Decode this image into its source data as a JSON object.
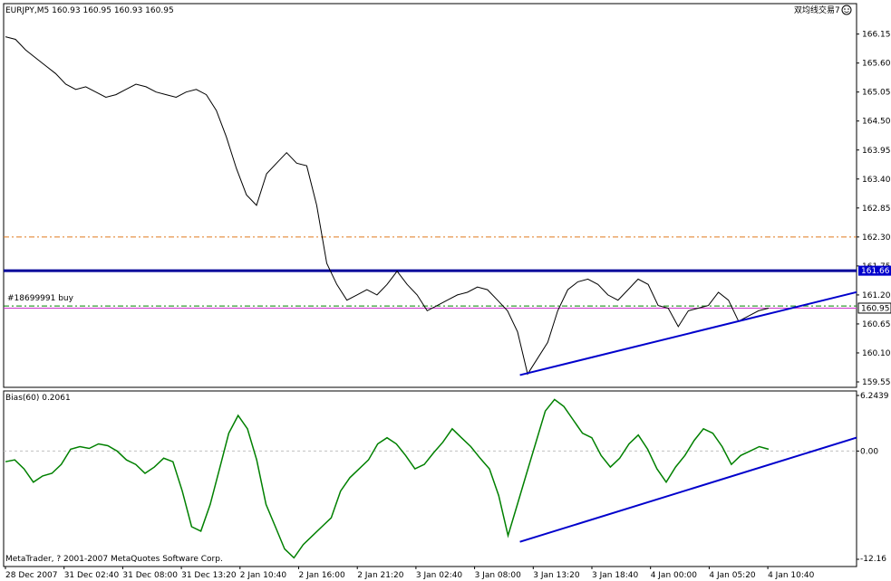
{
  "window": {
    "symbol_label": "EURJPY,M5  160.93 160.95 160.93 160.95",
    "ea_label": "双均线交易7",
    "copyright": "MetaTrader, ? 2001-2007 MetaQuotes Software Corp.",
    "indicator_label": "Bias(60) 0.2061",
    "order_label": "#18699991 buy"
  },
  "colors": {
    "price": "#000000",
    "bias": "#008000",
    "trendline": "#0000cc",
    "resistance": "#000099",
    "order_line": "#008000",
    "bid_line": "#cc33cc",
    "orange_level": "#e07a1f",
    "price_tag_bg": "#0000cc"
  },
  "chart_data": [
    {
      "type": "line",
      "title": "EURJPY,M5",
      "y_ticks": [
        "166.15",
        "165.60",
        "165.05",
        "164.50",
        "163.95",
        "163.40",
        "162.85",
        "162.30",
        "161.75",
        "161.20",
        "160.65",
        "160.10",
        "159.55"
      ],
      "ylim": [
        159.55,
        166.35
      ],
      "x_ticks": [
        "28 Dec 2007",
        "31 Dec 02:40",
        "31 Dec 08:00",
        "31 Dec 13:20",
        "2 Jan 10:40",
        "2 Jan 16:00",
        "2 Jan 21:20",
        "3 Jan 02:40",
        "3 Jan 08:00",
        "3 Jan 13:20",
        "3 Jan 18:40",
        "4 Jan 00:00",
        "4 Jan 05:20",
        "4 Jan 10:40"
      ],
      "price_tags": [
        "161.66",
        "160.95"
      ],
      "levels": {
        "orange": 162.3,
        "resistance": 161.66,
        "order": 160.99,
        "bid": 160.95
      },
      "trendline": {
        "from": [
          "3 Jan 08:00",
          159.68
        ],
        "to": [
          "4 Jan 10:40",
          161.05
        ]
      },
      "series": [
        {
          "values": [
            166.1,
            166.05,
            165.85,
            165.7,
            165.55,
            165.4,
            165.2,
            165.1,
            165.15,
            165.05,
            164.95,
            165.0,
            165.1,
            165.2,
            165.15,
            165.05,
            165.0,
            164.95,
            165.05,
            165.1,
            165.0,
            164.7,
            164.2,
            163.6,
            163.1,
            162.9,
            163.5,
            163.7,
            163.9,
            163.7,
            163.65,
            162.9,
            161.8,
            161.4,
            161.1,
            161.2,
            161.3,
            161.2,
            161.4,
            161.65,
            161.4,
            161.2,
            160.9,
            161.0,
            161.1,
            161.2,
            161.25,
            161.35,
            161.3,
            161.1,
            160.9,
            160.5,
            159.7,
            160.0,
            160.3,
            160.9,
            161.3,
            161.45,
            161.5,
            161.4,
            161.2,
            161.1,
            161.3,
            161.5,
            161.4,
            161.0,
            160.95,
            160.6,
            160.9,
            160.95,
            161.0,
            161.25,
            161.1,
            160.7,
            160.8,
            160.9,
            160.95
          ]
        }
      ]
    },
    {
      "type": "line",
      "title": "Bias(60) 0.2061",
      "y_ticks": [
        "6.2439",
        "0.00",
        "-12.16"
      ],
      "ylim": [
        -12.16,
        6.2439
      ],
      "trendline": {
        "from": [
          "3 Jan 08:00",
          -10.2
        ],
        "to": [
          "4 Jan 10:40",
          0.0
        ]
      },
      "series": [
        {
          "values": [
            -1.2,
            -1.0,
            -2.0,
            -3.5,
            -2.8,
            -2.5,
            -1.5,
            0.2,
            0.5,
            0.3,
            0.8,
            0.6,
            0.0,
            -1.0,
            -1.5,
            -2.5,
            -1.8,
            -0.8,
            -1.2,
            -4.5,
            -8.5,
            -9.0,
            -6.0,
            -2.0,
            2.0,
            4.0,
            2.5,
            -1.0,
            -6.0,
            -8.5,
            -11.0,
            -12.0,
            -10.5,
            -9.5,
            -8.5,
            -7.5,
            -4.5,
            -3.0,
            -2.0,
            -1.0,
            0.8,
            1.5,
            0.8,
            -0.5,
            -2.0,
            -1.5,
            -0.2,
            1.0,
            2.5,
            1.5,
            0.5,
            -0.8,
            -2.0,
            -5.0,
            -9.5,
            -6.0,
            -2.5,
            1.0,
            4.5,
            5.8,
            5.0,
            3.5,
            2.0,
            1.5,
            -0.5,
            -1.8,
            -0.8,
            0.8,
            1.8,
            0.2,
            -2.0,
            -3.5,
            -1.8,
            -0.5,
            1.2,
            2.5,
            2.0,
            0.5,
            -1.5,
            -0.5,
            0.0,
            0.5,
            0.2
          ]
        }
      ]
    }
  ]
}
